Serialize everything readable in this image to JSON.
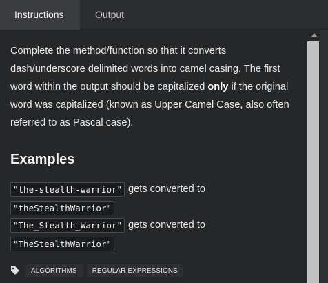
{
  "tabs": [
    {
      "label": "Instructions",
      "active": true
    },
    {
      "label": "Output",
      "active": false
    }
  ],
  "description": {
    "part1": "Complete the method/function so that it converts dash/underscore delimited words into camel casing. The first word within the output should be capitalized ",
    "bold": "only",
    "part2": " if the original word was capitalized (known as Upper Camel Case, also often referred to as Pascal case)."
  },
  "examples": {
    "title": "Examples",
    "items": [
      {
        "input": "\"the-stealth-warrior\"",
        "connector": "gets converted to",
        "output": "\"theStealthWarrior\""
      },
      {
        "input": "\"The_Stealth_Warrior\"",
        "connector": "gets converted to",
        "output": "\"TheStealthWarrior\""
      }
    ]
  },
  "tags": {
    "icon": "tag-icon",
    "items": [
      "ALGORITHMS",
      "REGULAR EXPRESSIONS"
    ]
  },
  "colors": {
    "background": "#262729",
    "tab_bar": "#2c2d30",
    "active_tab": "#3a3b3f",
    "scroll_thumb": "#c1c1c1"
  }
}
